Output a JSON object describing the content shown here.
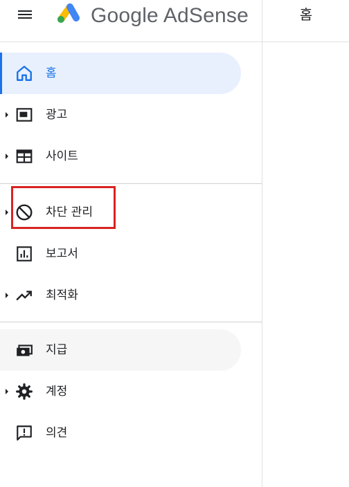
{
  "header": {
    "brand": "Google AdSense",
    "page_title": "홈"
  },
  "colors": {
    "accent": "#1a73e8",
    "active_bg": "#e8f0fe",
    "highlight_box": "#d92222"
  },
  "sidebar": {
    "items": [
      {
        "label": "홈",
        "icon": "home-icon",
        "expandable": false,
        "state": "active"
      },
      {
        "label": "광고",
        "icon": "ad-icon",
        "expandable": true
      },
      {
        "label": "사이트",
        "icon": "site-icon",
        "expandable": true
      },
      {
        "label": "차단 관리",
        "icon": "block-icon",
        "expandable": true,
        "highlighted": true
      },
      {
        "label": "보고서",
        "icon": "report-icon",
        "expandable": false
      },
      {
        "label": "최적화",
        "icon": "trending-up-icon",
        "expandable": true
      },
      {
        "label": "지급",
        "icon": "payments-icon",
        "expandable": false,
        "state": "hover"
      },
      {
        "label": "계정",
        "icon": "gear-icon",
        "expandable": true
      },
      {
        "label": "의견",
        "icon": "feedback-icon",
        "expandable": false
      }
    ]
  }
}
